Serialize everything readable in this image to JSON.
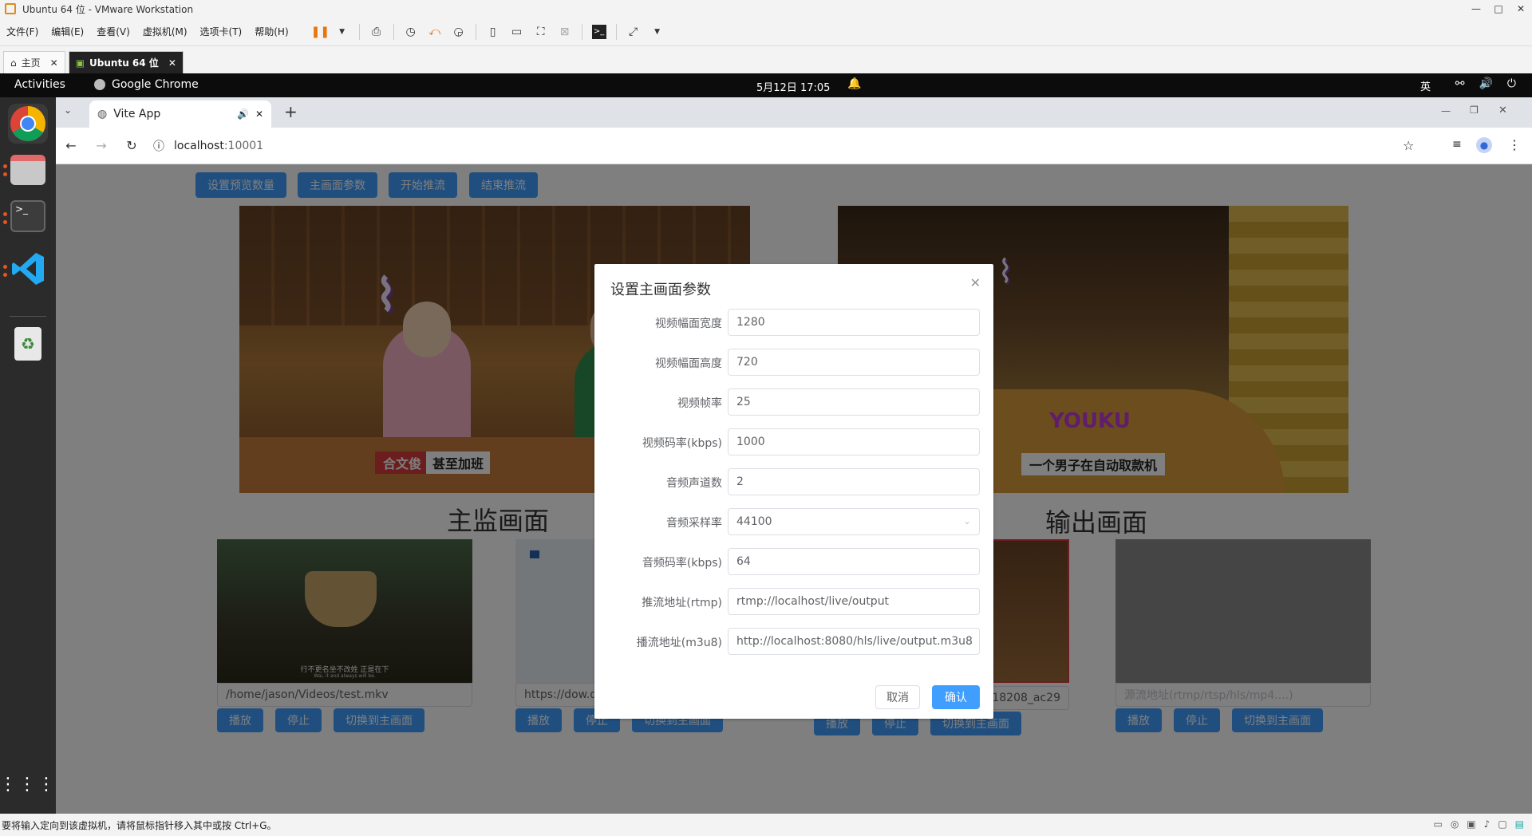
{
  "vm": {
    "title": "Ubuntu 64 位 - VMware Workstation",
    "menu": [
      "文件(F)",
      "编辑(E)",
      "查看(V)",
      "虚拟机(M)",
      "选项卡(T)",
      "帮助(H)"
    ],
    "tabs": [
      {
        "label": "主页",
        "icon": "home-icon"
      },
      {
        "label": "Ubuntu 64 位",
        "icon": "vm-icon"
      }
    ],
    "status_text": "要将输入定向到该虚拟机，请将鼠标指针移入其中或按 Ctrl+G。"
  },
  "ubuntu": {
    "activities": "Activities",
    "app_name": "Google Chrome",
    "clock": "5月12日  17:05",
    "ime": "英"
  },
  "chrome": {
    "tab_title": "Vite App",
    "url_host": "localhost",
    "url_port": ":10001"
  },
  "page": {
    "toolbar": [
      "设置预览数量",
      "主画面参数",
      "开始推流",
      "结束推流"
    ],
    "main_caption": "主监画面",
    "output_caption": "输出画面",
    "main_video_texts": [
      "合文俊",
      "甚至加班"
    ],
    "output_video_texts": [
      "YOUKU",
      "一个男子在自动取款机"
    ],
    "sources": [
      {
        "path": "/home/jason/Videos/test.mkv",
        "subtitle_cn": "行不更名坐不改姓 正是在下",
        "subtitle_en": "Wai, it and always will be."
      },
      {
        "path": "https://dow.do"
      },
      {
        "path": "7/18208_ac29"
      },
      {
        "path": "",
        "placeholder": "源流地址(rtmp/rtsp/hls/mp4....)"
      }
    ],
    "source_buttons": {
      "play": "播放",
      "stop": "停止",
      "switch": "切换到主画面"
    }
  },
  "dialog": {
    "title": "设置主画面参数",
    "fields": [
      {
        "label": "视频幅面宽度",
        "value": "1280"
      },
      {
        "label": "视频幅面高度",
        "value": "720"
      },
      {
        "label": "视频帧率",
        "value": "25"
      },
      {
        "label": "视频码率(kbps)",
        "value": "1000"
      },
      {
        "label": "音频声道数",
        "value": "2"
      },
      {
        "label": "音频采样率",
        "value": "44100",
        "select": true
      },
      {
        "label": "音频码率(kbps)",
        "value": "64"
      },
      {
        "label": "推流地址(rtmp)",
        "value": "rtmp://localhost/live/output"
      },
      {
        "label": "播流地址(m3u8)",
        "value": "http://localhost:8080/hls/live/output.m3u8"
      }
    ],
    "cancel": "取消",
    "ok": "确认"
  }
}
